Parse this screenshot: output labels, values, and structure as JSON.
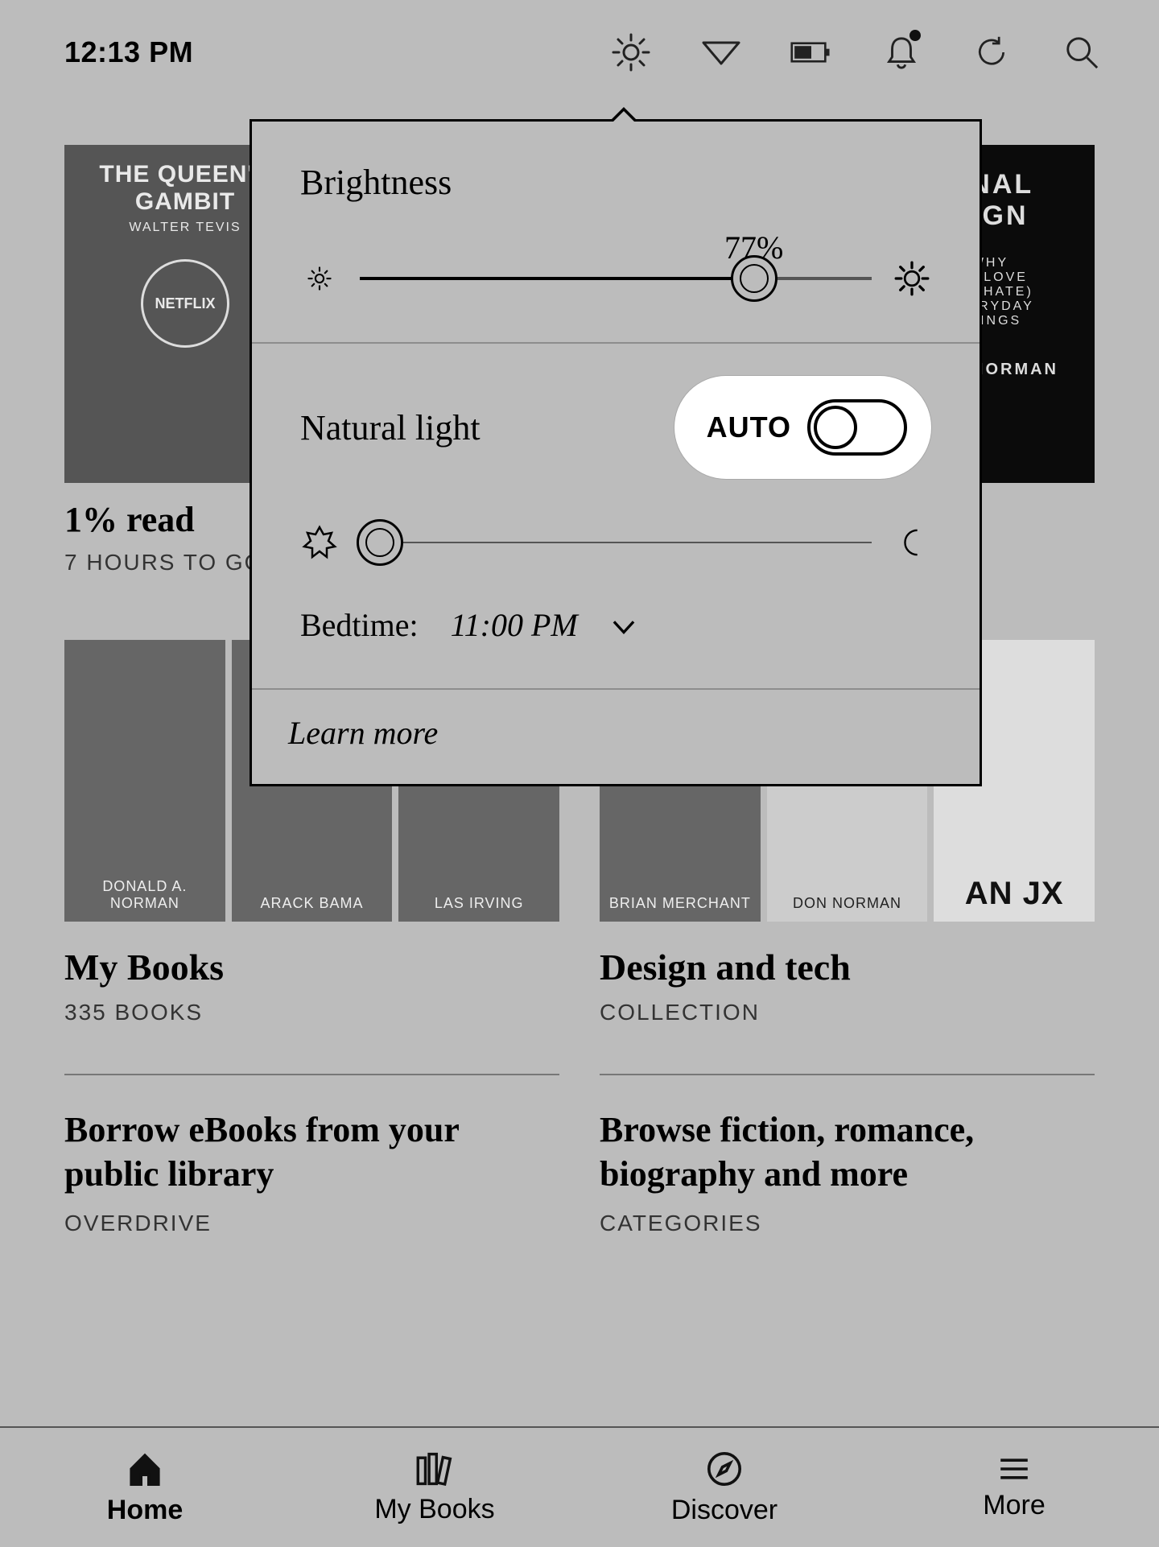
{
  "status": {
    "time": "12:13 PM"
  },
  "popover": {
    "brightness_title": "Brightness",
    "brightness_value": "77%",
    "brightness_pct": 77,
    "natural_light_title": "Natural light",
    "auto_label": "AUTO",
    "auto_on": false,
    "natural_light_pct": 4,
    "bedtime_label": "Bedtime:",
    "bedtime_value": "11:00 PM",
    "learn_more": "Learn more"
  },
  "home": {
    "current": {
      "cover_title": "THE QUEEN'S GAMBIT",
      "cover_author": "WALTER TEVIS",
      "cover_badge": "NETFLIX",
      "progress": "1% read",
      "eta": "7 HOURS TO GO"
    },
    "right_cover": {
      "line1": "ONAL",
      "line2": "SIGN",
      "tag1": "WHY",
      "tag2": "WE LOVE",
      "tag3": "(OR HATE)",
      "tag4": "EVERYDAY",
      "tag5": "THINGS",
      "author": "DON NORMAN"
    },
    "sections": [
      {
        "title": "My Books",
        "subtitle": "335 BOOKS",
        "covers": [
          "DONALD A. NORMAN",
          "ARACK BAMA",
          "LAS IRVING"
        ]
      },
      {
        "title": "Design and tech",
        "subtitle": "COLLECTION",
        "covers": [
          "BRIAN MERCHANT",
          "DON NORMAN",
          "AN JX"
        ]
      }
    ],
    "links": [
      {
        "title": "Borrow eBooks from your public library",
        "subtitle": "OVERDRIVE"
      },
      {
        "title": "Browse fiction, romance, biography and more",
        "subtitle": "CATEGORIES"
      }
    ]
  },
  "tabs": [
    {
      "label": "Home",
      "active": true
    },
    {
      "label": "My Books",
      "active": false
    },
    {
      "label": "Discover",
      "active": false
    },
    {
      "label": "More",
      "active": false
    }
  ]
}
